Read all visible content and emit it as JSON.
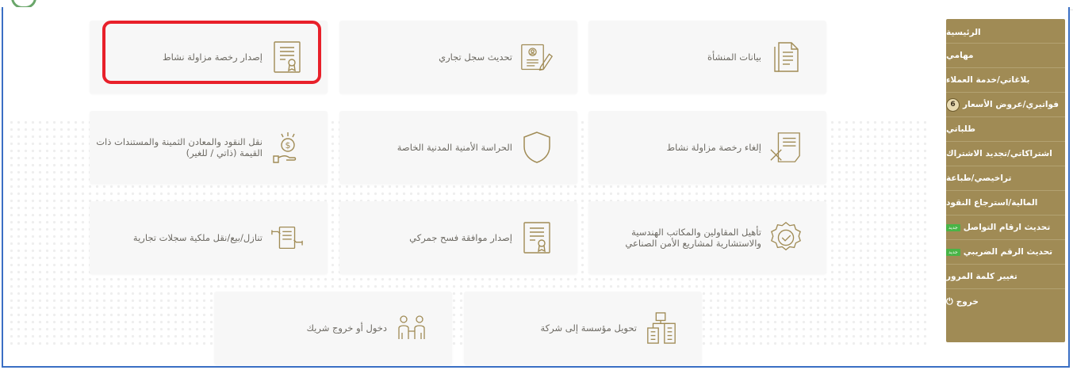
{
  "colors": {
    "accent": "#a08b55",
    "highlight": "#e8202a",
    "frame": "#3a6fc4",
    "icon": "#a08b55"
  },
  "services": [
    {
      "label": "بيانات المنشأة",
      "icon": "document-list-icon"
    },
    {
      "label": "تحديث سجل تجاري",
      "icon": "certificate-edit-icon"
    },
    {
      "label": "إصدار رخصة مزاولة نشاط",
      "icon": "license-award-icon"
    },
    {
      "label": "إلغاء رخصة مزاولة نشاط",
      "icon": "document-cancel-icon"
    },
    {
      "label": "الحراسة الأمنية المدنية الخاصة",
      "icon": "shield-icon"
    },
    {
      "label": "نقل النقود والمعادن الثمينة والمستندات ذات القيمة (ذاتي / للغير)",
      "icon": "money-hand-icon"
    },
    {
      "label": "تأهيل المقاولين والمكاتب الهندسية والاستشارية لمشاريع الأمن الصناعي",
      "icon": "badge-check-icon"
    },
    {
      "label": "إصدار موافقة فسح جمركي",
      "icon": "customs-document-icon"
    },
    {
      "label": "تنازل/بيع/نقل ملكية سجلات تجارية",
      "icon": "document-transfer-icon"
    },
    {
      "label": "تحويل مؤسسة إلى شركة",
      "icon": "buildings-icon"
    },
    {
      "label": "دخول أو خروج شريك",
      "icon": "partners-icon"
    }
  ],
  "sidebar": {
    "items": [
      {
        "label": "الرئيسية"
      },
      {
        "label": "مهامي"
      },
      {
        "label": "بلاغاتي/خدمة العملاء"
      },
      {
        "label": "فواتيري/عروض الأسعار",
        "badge": "6"
      },
      {
        "label": "طلباتي"
      },
      {
        "label": "اشتراكاتي/تجديد الاشتراك"
      },
      {
        "label": "تراخيصي/طباعة"
      },
      {
        "label": "المالية/استرجاع النقود"
      },
      {
        "label": "تحديث ارقام التواصل",
        "tag": "جديد"
      },
      {
        "label": "تحديث الرقم الضريبي",
        "tag": "جديد"
      },
      {
        "label": "تغيير كلمة المرور"
      },
      {
        "label": "خروج",
        "icon": "power-icon"
      }
    ]
  }
}
